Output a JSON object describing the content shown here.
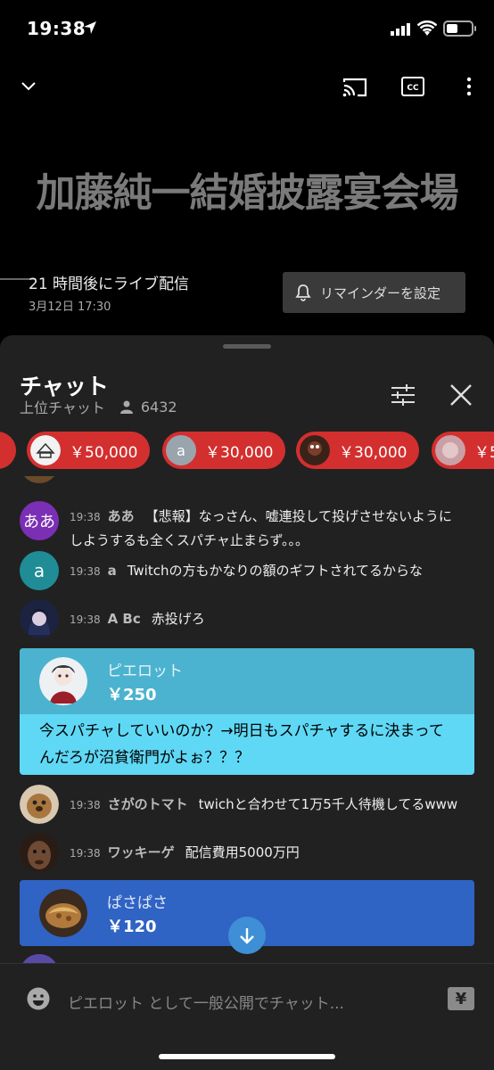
{
  "status_bar": {
    "time": "19:38"
  },
  "video": {
    "overlay_title": "加藤純一結婚披露宴会場",
    "schedule_text": "21 時間後にライブ配信",
    "schedule_date": "3月12日 17:30",
    "reminder_label": "リマインダーを設定"
  },
  "chat": {
    "title": "チャット",
    "mode": "上位チャット",
    "viewers": "6432",
    "ticker": [
      {
        "amount": "￥50,000",
        "color": "#d32f2f"
      },
      {
        "amount": "￥30,000",
        "avatar_letter": "a",
        "color": "#d32f2f"
      },
      {
        "amount": "￥30,000",
        "color": "#d32f2f"
      },
      {
        "amount": "￥5",
        "color": "#d32f2f"
      }
    ],
    "messages": [
      {
        "time": "19:38",
        "author": "ああ",
        "avatar_text": "ああ",
        "text": "【悲報】なっさん、嘘連投して投げさせないようにしようするも全くスパチャ止まらず。。。"
      },
      {
        "time": "19:38",
        "author": "a",
        "avatar_text": "a",
        "text": "Twitchの方もかなりの額のギフトされてるからな"
      },
      {
        "time": "19:38",
        "author": "A Bc",
        "text": "赤投げろ"
      },
      {
        "time": "19:38",
        "author": "さがのトマト",
        "text": "twichと合わせて1万5千人待機してるwww"
      },
      {
        "time": "19:38",
        "author": "ワッキーゲ",
        "text": "配信費用5000万円"
      }
    ],
    "superchats": [
      {
        "name": "ピエロット",
        "amount": "￥250",
        "text": "今スパチャしていいのか？→明日もスパチャするに決まってんだろが沼貧衛門がよぉ？？？",
        "head_color": "#4bb3cf",
        "body_color": "#5fd8f5"
      },
      {
        "name": "ぱさぱさ",
        "amount": "￥120",
        "head_color": "#2f63c4"
      }
    ],
    "input_placeholder": "ピエロット として一般公開でチャット...",
    "yen_label": "¥"
  }
}
